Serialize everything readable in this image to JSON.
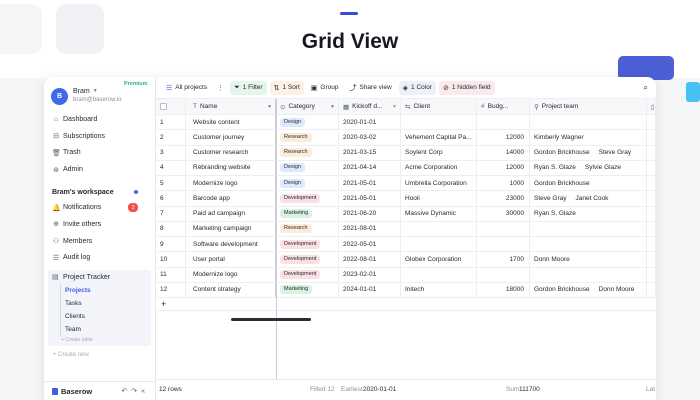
{
  "page": {
    "title": "Grid View"
  },
  "sidebar": {
    "user": {
      "initial": "B",
      "name": "Bram",
      "email": "bram@baserow.io",
      "plan": "Premium"
    },
    "nav": [
      {
        "icon": "dashboard-icon",
        "glyph": "⌂",
        "label": "Dashboard"
      },
      {
        "icon": "subscriptions-icon",
        "glyph": "⊟",
        "label": "Subscriptions"
      },
      {
        "icon": "trash-icon",
        "glyph": "🗑",
        "label": "Trash"
      },
      {
        "icon": "admin-icon",
        "glyph": "⊛",
        "label": "Admin"
      }
    ],
    "workspace": {
      "title": "Bram's workspace",
      "items": [
        {
          "icon": "bell-icon",
          "glyph": "🔔",
          "label": "Notifications",
          "badge": "2"
        },
        {
          "icon": "invite-icon",
          "glyph": "⊕",
          "label": "Invite others"
        },
        {
          "icon": "members-icon",
          "glyph": "⚇",
          "label": "Members"
        },
        {
          "icon": "audit-log-icon",
          "glyph": "☰",
          "label": "Audit log"
        }
      ]
    },
    "database": {
      "name": "Project Tracker",
      "tables": [
        "Projects",
        "Tasks",
        "Clients",
        "Team"
      ],
      "active_table": "Projects",
      "create_table": "+ Create table"
    },
    "create_new": "+  Create new",
    "logo": "Baserow"
  },
  "toolbar": {
    "view": "All projects",
    "filter": "1 Filter",
    "sort": "1 Sort",
    "group": "Group",
    "share": "Share view",
    "color": "1 Color",
    "hidden": "1 hidden field"
  },
  "grid": {
    "columns": [
      "Name",
      "Category",
      "Kickoff d...",
      "Client",
      "Budg...",
      "Project team"
    ],
    "rows": [
      {
        "id": "1",
        "name": "Website content",
        "category": "Design",
        "kickoff": "2020-01-01",
        "client": "",
        "budget": "",
        "team": []
      },
      {
        "id": "2",
        "name": "Customer journey",
        "category": "Research",
        "kickoff": "2020-03-02",
        "client": "Vehement Capital Pa...",
        "budget": "12000",
        "team": [
          "Kimberly Wagner"
        ]
      },
      {
        "id": "3",
        "name": "Customer research",
        "category": "Research",
        "kickoff": "2021-03-15",
        "client": "Soylent Corp",
        "budget": "14000",
        "team": [
          "Gordon Brickhouse",
          "Steve Gray"
        ]
      },
      {
        "id": "4",
        "name": "Rebranding website",
        "category": "Design",
        "kickoff": "2021-04-14",
        "client": "Acme Corporation",
        "budget": "12000",
        "team": [
          "Ryan S. Glaze",
          "Sylvie Glaze"
        ]
      },
      {
        "id": "5",
        "name": "Modernize logo",
        "category": "Design",
        "kickoff": "2021-05-01",
        "client": "Umbrella Corporation",
        "budget": "1000",
        "team": [
          "Gordon Brickhouse"
        ]
      },
      {
        "id": "6",
        "name": "Barcode app",
        "category": "Development",
        "kickoff": "2021-05-01",
        "client": "Hooli",
        "budget": "23000",
        "team": [
          "Steve Gray",
          "Janet Cook"
        ]
      },
      {
        "id": "7",
        "name": "Paid ad campaign",
        "category": "Marketing",
        "kickoff": "2021-06-20",
        "client": "Massive Dynamic",
        "budget": "30000",
        "team": [
          "Ryan S. Glaze"
        ]
      },
      {
        "id": "8",
        "name": "Marketing campaign",
        "category": "Research",
        "kickoff": "2021-08-01",
        "client": "",
        "budget": "",
        "team": []
      },
      {
        "id": "9",
        "name": "Software development",
        "category": "Development",
        "kickoff": "2022-05-01",
        "client": "",
        "budget": "",
        "team": []
      },
      {
        "id": "10",
        "name": "User portal",
        "category": "Development",
        "kickoff": "2022-08-01",
        "client": "Globex Corporation",
        "budget": "1700",
        "team": [
          "Donn Moore"
        ]
      },
      {
        "id": "11",
        "name": "Modernize logo",
        "category": "Development",
        "kickoff": "2023-02-01",
        "client": "",
        "budget": "",
        "team": []
      },
      {
        "id": "12",
        "name": "Content strategy",
        "category": "Marketing",
        "kickoff": "2024-01-01",
        "client": "Initech",
        "budget": "18000",
        "team": [
          "Gordon Brickhouse",
          "Donn Moore"
        ]
      }
    ],
    "add_row": "+"
  },
  "footer": {
    "rows": "12 rows",
    "filled": "Filled 12",
    "earliest_label": "Earliest",
    "earliest_value": "2020-01-01",
    "sum_label": "Sum",
    "sum_value": "111700",
    "latest_label": "Lat"
  },
  "colors": {
    "accent": "#3f5fd8",
    "design": "#dfe9fb",
    "research": "#fdecd7",
    "development": "#fbdfe2",
    "marketing": "#d9f1df"
  }
}
